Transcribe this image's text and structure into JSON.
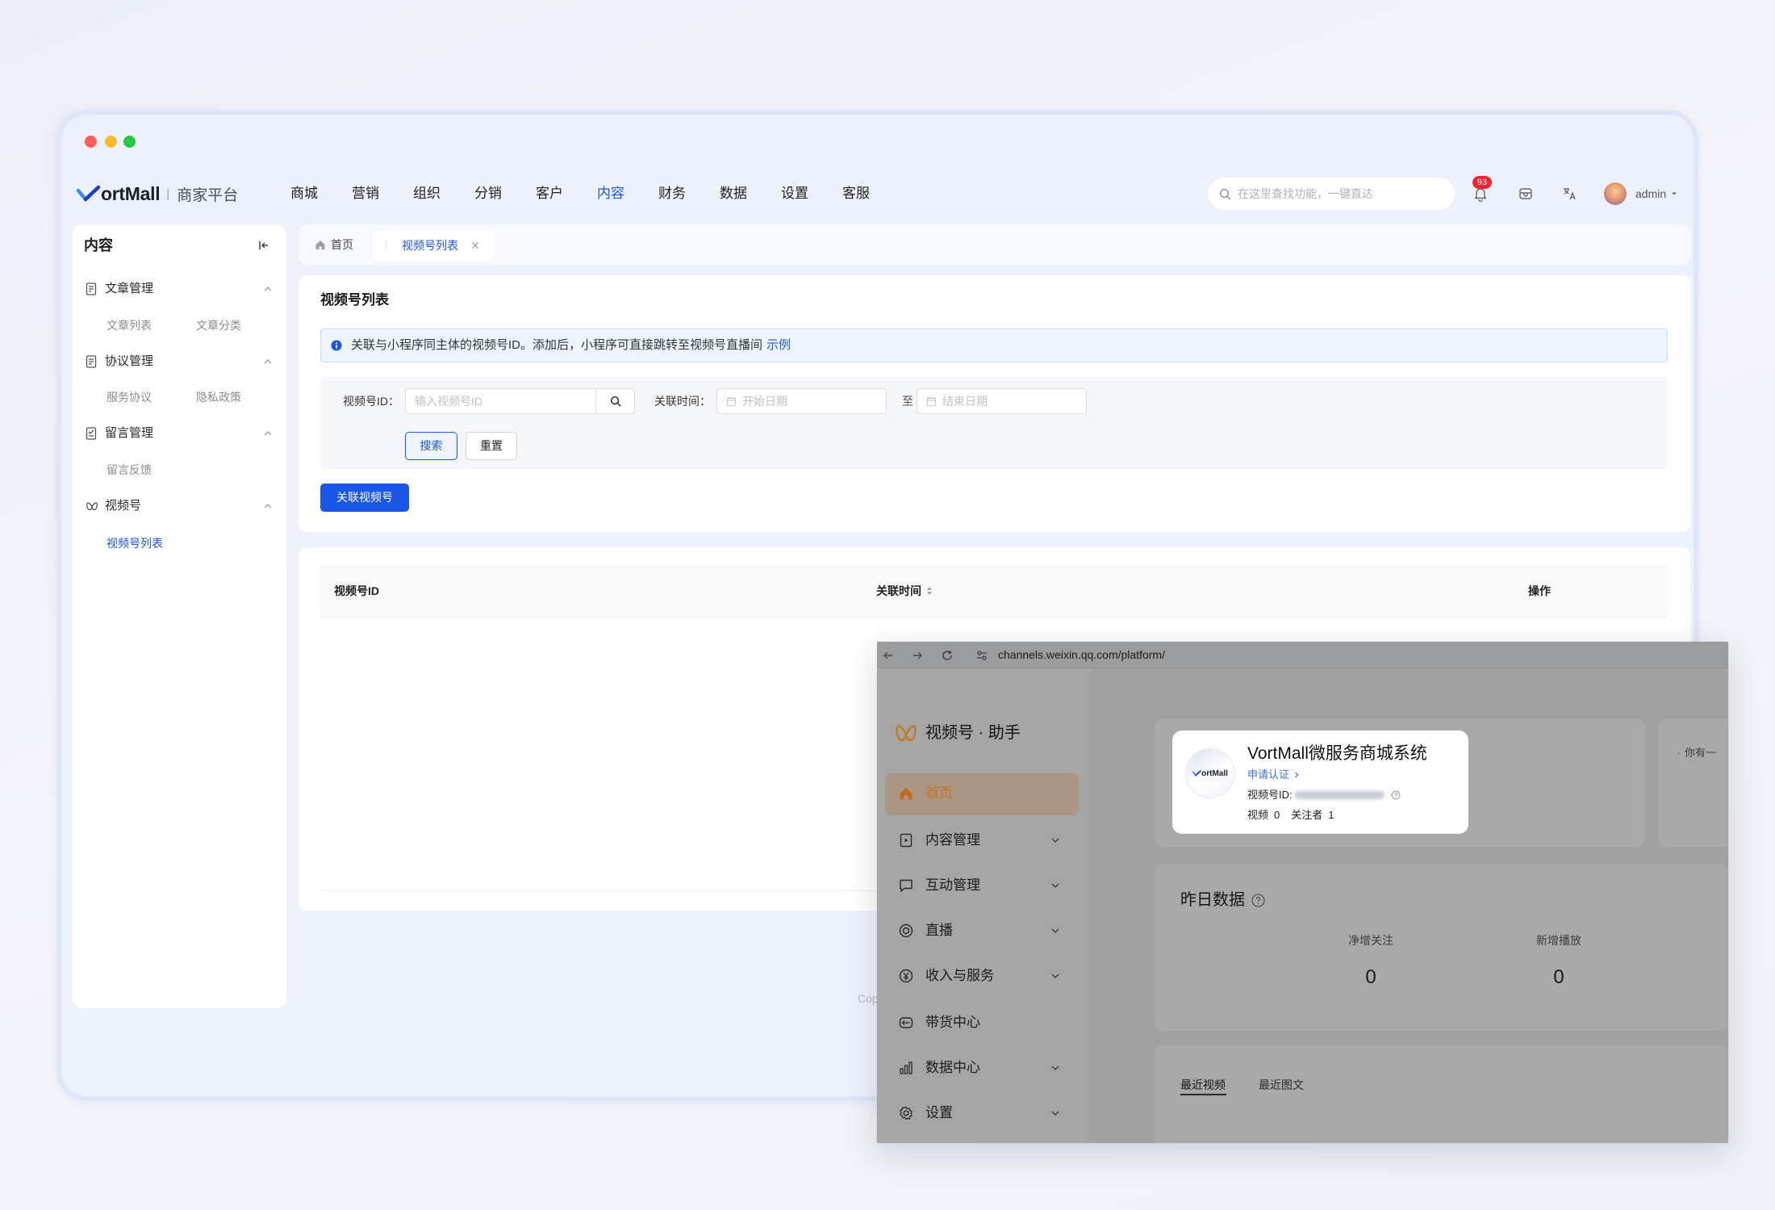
{
  "accent_color": "#1a57e8",
  "window": {
    "controls": [
      {
        "name": "close",
        "color": "#ff5f57"
      },
      {
        "name": "minimize",
        "color": "#febc2e"
      },
      {
        "name": "maximize",
        "color": "#28c840"
      }
    ]
  },
  "header": {
    "brand": "ortMall",
    "divider": "|",
    "subtitle": "商家平台",
    "nav": [
      {
        "label": "商城"
      },
      {
        "label": "营销"
      },
      {
        "label": "组织"
      },
      {
        "label": "分销"
      },
      {
        "label": "客户"
      },
      {
        "label": "内容",
        "active": true
      },
      {
        "label": "财务"
      },
      {
        "label": "数据"
      },
      {
        "label": "设置"
      },
      {
        "label": "客服"
      }
    ],
    "search": {
      "placeholder": "在这里查找功能，一键直达",
      "icon": "search-icon"
    },
    "notifications": {
      "count": "93",
      "icon": "bell-icon"
    },
    "user": {
      "name": "admin"
    }
  },
  "sidebar": {
    "title": "内容",
    "groups": [
      {
        "label": "文章管理",
        "icon": "document-icon",
        "items": [
          {
            "label": "文章列表"
          },
          {
            "label": "文章分类"
          }
        ]
      },
      {
        "label": "协议管理",
        "icon": "agreement-icon",
        "items": [
          {
            "label": "服务协议"
          },
          {
            "label": "隐私政策"
          }
        ]
      },
      {
        "label": "留言管理",
        "icon": "message-icon",
        "items": [
          {
            "label": "留言反馈"
          }
        ]
      },
      {
        "label": "视频号",
        "icon": "channels-icon",
        "items": [
          {
            "label": "视频号列表",
            "active": true
          }
        ]
      }
    ]
  },
  "tabs": [
    {
      "label": "首页",
      "icon": "home-icon"
    },
    {
      "label": "视频号列表",
      "active": true
    }
  ],
  "main": {
    "title": "视频号列表",
    "alert": {
      "text": "关联与小程序同主体的视频号ID。添加后，小程序可直接跳转至视频号直播间",
      "link": "示例"
    },
    "filters": {
      "channel_id": {
        "label": "视频号ID：",
        "placeholder": "输入视频号ID"
      },
      "time": {
        "label": "关联时间：",
        "start_placeholder": "开始日期",
        "separator": "至",
        "end_placeholder": "结束日期"
      },
      "search_button": "搜索",
      "reset_button": "重置"
    },
    "link_button": "关联视频号"
  },
  "table": {
    "columns": [
      {
        "label": "视频号ID"
      },
      {
        "label": "关联时间",
        "sortable": true
      },
      {
        "label": "操作"
      }
    ],
    "rows": []
  },
  "footer": {
    "text": "Cop"
  },
  "overlay": {
    "browser": {
      "url": "channels.weixin.qq.com/platform/"
    },
    "app_title": "视频号 · 助手",
    "nav": [
      {
        "label": "首页",
        "icon": "home-icon",
        "active": true
      },
      {
        "label": "内容管理",
        "icon": "content-icon",
        "expandable": true
      },
      {
        "label": "互动管理",
        "icon": "comment-icon",
        "expandable": true
      },
      {
        "label": "直播",
        "icon": "live-icon",
        "expandable": true
      },
      {
        "label": "收入与服务",
        "icon": "income-icon",
        "expandable": true
      },
      {
        "label": "带货中心",
        "icon": "handshake-icon"
      },
      {
        "label": "数据中心",
        "icon": "chart-icon",
        "expandable": true
      },
      {
        "label": "设置",
        "icon": "gear-icon",
        "expandable": true
      }
    ],
    "profile": {
      "logo_text": "ortMall",
      "name": "VortMall微服务商城系统",
      "verify_link": "申请认证",
      "id_label": "视频号ID:",
      "videos_label": "视频",
      "videos": "0",
      "followers_label": "关注者",
      "followers": "1"
    },
    "notice": {
      "text": "你有一"
    },
    "yesterday": {
      "title": "昨日数据",
      "metrics": [
        {
          "label": "净增关注",
          "value": "0"
        },
        {
          "label": "新增播放",
          "value": "0"
        }
      ]
    },
    "content_tabs": [
      {
        "label": "最近视频",
        "active": true
      },
      {
        "label": "最近图文"
      }
    ]
  }
}
